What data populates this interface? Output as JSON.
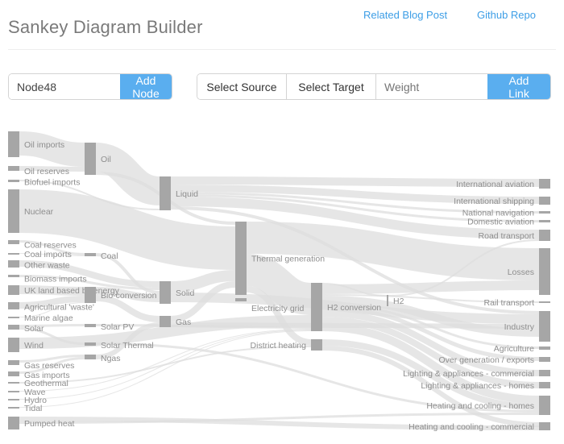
{
  "header": {
    "title": "Sankey Diagram Builder",
    "blog_link": "Related Blog Post",
    "github_link": "Github Repo"
  },
  "node_form": {
    "value": "Node48",
    "add_label": "Add Node"
  },
  "link_form": {
    "source_label": "Select Source",
    "target_label": "Select Target",
    "weight_placeholder": "Weight",
    "add_label": "Add Link"
  },
  "colors": {
    "accent": "#5aaeef",
    "link_text": "#3d9ee6",
    "node": "#a6a6a6",
    "flow": "#dedede"
  },
  "sankey": {
    "nodes": [
      {
        "id": "oil_imports",
        "label": "Oil imports"
      },
      {
        "id": "oil_reserves",
        "label": "Oil reserves"
      },
      {
        "id": "biofuel_imports",
        "label": "Biofuel imports"
      },
      {
        "id": "nuclear",
        "label": "Nuclear"
      },
      {
        "id": "coal_reserves",
        "label": "Coal reserves"
      },
      {
        "id": "coal_imports",
        "label": "Coal imports"
      },
      {
        "id": "other_waste",
        "label": "Other waste"
      },
      {
        "id": "biomass_imports",
        "label": "Biomass imports"
      },
      {
        "id": "uk_land",
        "label": "UK land based bioenergy"
      },
      {
        "id": "ag_waste",
        "label": "Agricultural 'waste'"
      },
      {
        "id": "marine_algae",
        "label": "Marine algae"
      },
      {
        "id": "solar_src",
        "label": "Solar"
      },
      {
        "id": "wind",
        "label": "Wind"
      },
      {
        "id": "gas_reserves",
        "label": "Gas reserves"
      },
      {
        "id": "gas_imports",
        "label": "Gas imports"
      },
      {
        "id": "geothermal",
        "label": "Geothermal"
      },
      {
        "id": "wave",
        "label": "Wave"
      },
      {
        "id": "hydro",
        "label": "Hydro"
      },
      {
        "id": "tidal",
        "label": "Tidal"
      },
      {
        "id": "pumped_heat",
        "label": "Pumped heat"
      },
      {
        "id": "oil",
        "label": "Oil"
      },
      {
        "id": "coal",
        "label": "Coal"
      },
      {
        "id": "bio_conversion",
        "label": "Bio-conversion"
      },
      {
        "id": "solar_pv",
        "label": "Solar PV"
      },
      {
        "id": "solar_thermal",
        "label": "Solar Thermal"
      },
      {
        "id": "ngas",
        "label": "Ngas"
      },
      {
        "id": "liquid",
        "label": "Liquid"
      },
      {
        "id": "solid",
        "label": "Solid"
      },
      {
        "id": "gas",
        "label": "Gas"
      },
      {
        "id": "thermal_gen",
        "label": "Thermal generation"
      },
      {
        "id": "electricity_grid",
        "label": "Electricity grid"
      },
      {
        "id": "district_heating",
        "label": "District heating"
      },
      {
        "id": "h2_conversion",
        "label": "H2 conversion"
      },
      {
        "id": "h2",
        "label": "H2"
      },
      {
        "id": "intl_aviation",
        "label": "International aviation"
      },
      {
        "id": "intl_shipping",
        "label": "International shipping"
      },
      {
        "id": "national_nav",
        "label": "National navigation"
      },
      {
        "id": "domestic_aviation",
        "label": "Domestic aviation"
      },
      {
        "id": "road_transport",
        "label": "Road transport"
      },
      {
        "id": "losses",
        "label": "Losses"
      },
      {
        "id": "rail_transport",
        "label": "Rail transport"
      },
      {
        "id": "industry",
        "label": "Industry"
      },
      {
        "id": "agriculture",
        "label": "Agriculture"
      },
      {
        "id": "over_generation",
        "label": "Over generation / exports"
      },
      {
        "id": "lighting_commercial",
        "label": "Lighting & appliances - commercial"
      },
      {
        "id": "lighting_homes",
        "label": "Lighting & appliances - homes"
      },
      {
        "id": "heating_homes",
        "label": "Heating and cooling - homes"
      },
      {
        "id": "heating_commercial",
        "label": "Heating and cooling - commercial"
      }
    ]
  }
}
